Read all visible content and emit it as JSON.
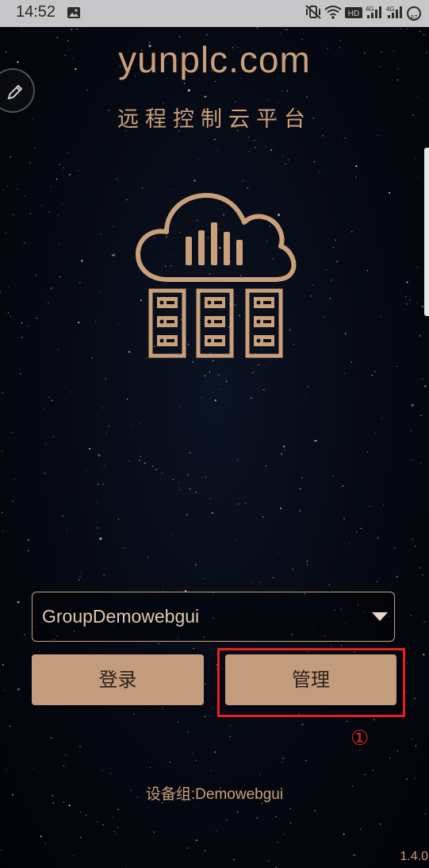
{
  "status_bar": {
    "time": "14:52",
    "battery": "97",
    "icons": [
      "image-icon",
      "mute-vibrate-icon",
      "wifi-icon",
      "hd-icon",
      "signal-4g-icon",
      "signal-4g-icon",
      "battery-icon"
    ]
  },
  "app": {
    "title": "yunplc.com",
    "subtitle": "远程控制云平台"
  },
  "group_select": {
    "value": "GroupDemowebgui"
  },
  "buttons": {
    "login": "登录",
    "manage": "管理"
  },
  "annotation": {
    "step_marker": "①",
    "highlight_color": "#e8201e"
  },
  "device_group": "设备组:Demowebgui",
  "version": "1.4.0",
  "colors": {
    "accent": "#c9a07a",
    "button_bg": "#c29c7c",
    "background": "#05070d"
  }
}
